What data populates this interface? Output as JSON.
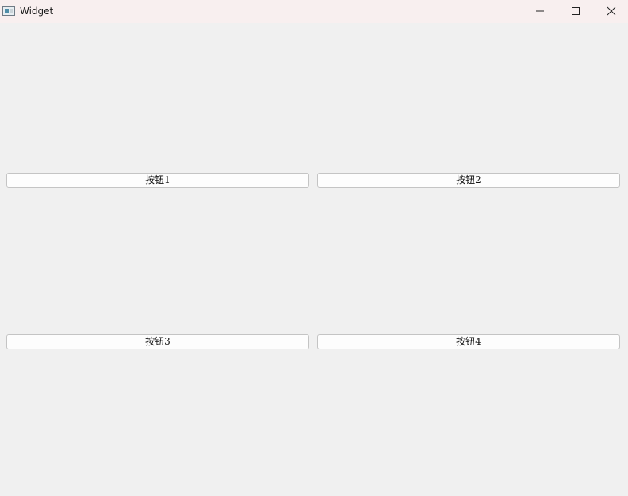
{
  "window": {
    "title": "Widget",
    "app_icon": "window-app-icon",
    "controls": [
      "minimize-icon",
      "maximize-icon",
      "close-icon"
    ]
  },
  "buttons": [
    {
      "label": "按钮1"
    },
    {
      "label": "按钮2"
    },
    {
      "label": "按钮3"
    },
    {
      "label": "按钮4"
    }
  ]
}
